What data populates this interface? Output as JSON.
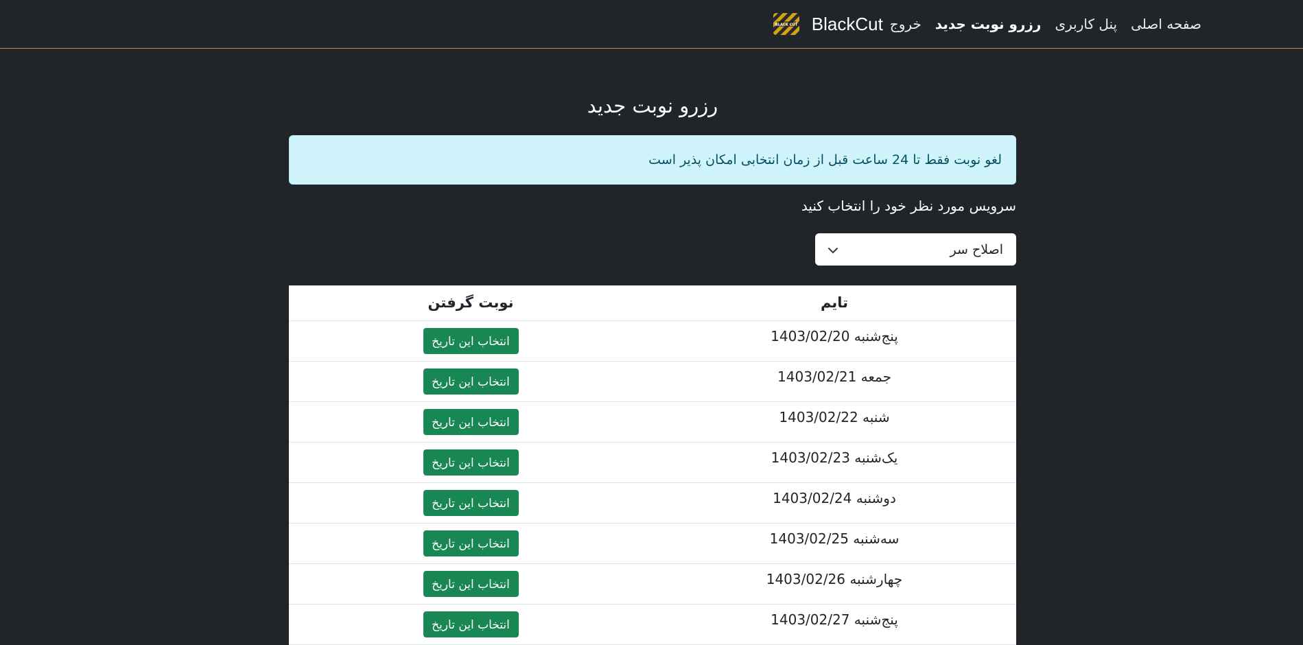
{
  "navbar": {
    "brand": "BlackCut",
    "logo_text": "BLACK CUT",
    "links": [
      {
        "label": "صفحه اصلی",
        "active": false
      },
      {
        "label": "پنل کاربری",
        "active": false
      },
      {
        "label": "رزرو نوبت جدید",
        "active": true
      },
      {
        "label": "خروج",
        "active": false
      }
    ]
  },
  "main": {
    "title": "رزرو نوبت جدید",
    "alert": "لغو نوبت فقط تا 24 ساعت قبل از زمان انتخابی امکان پذیر است",
    "service_label": "سرویس مورد نظر خود را انتخاب کنید",
    "service_selected": "اصلاح سر"
  },
  "table": {
    "headers": {
      "time": "تایم",
      "book": "نوبت گرفتن"
    },
    "button_label": "انتخاب این تاریخ",
    "rows": [
      {
        "day": "پنج‌شنبه",
        "date": "1403/02/20"
      },
      {
        "day": "جمعه",
        "date": "1403/02/21"
      },
      {
        "day": "شنبه",
        "date": "1403/02/22"
      },
      {
        "day": "یک‌شنبه",
        "date": "1403/02/23"
      },
      {
        "day": "دوشنبه",
        "date": "1403/02/24"
      },
      {
        "day": "سه‌شنبه",
        "date": "1403/02/25"
      },
      {
        "day": "چهارشنبه",
        "date": "1403/02/26"
      },
      {
        "day": "پنج‌شنبه",
        "date": "1403/02/27"
      }
    ]
  },
  "colors": {
    "background": "#212529",
    "accent_border": "#b8962e",
    "alert_bg": "#cff4fc",
    "alert_text": "#055160",
    "button": "#198754"
  }
}
